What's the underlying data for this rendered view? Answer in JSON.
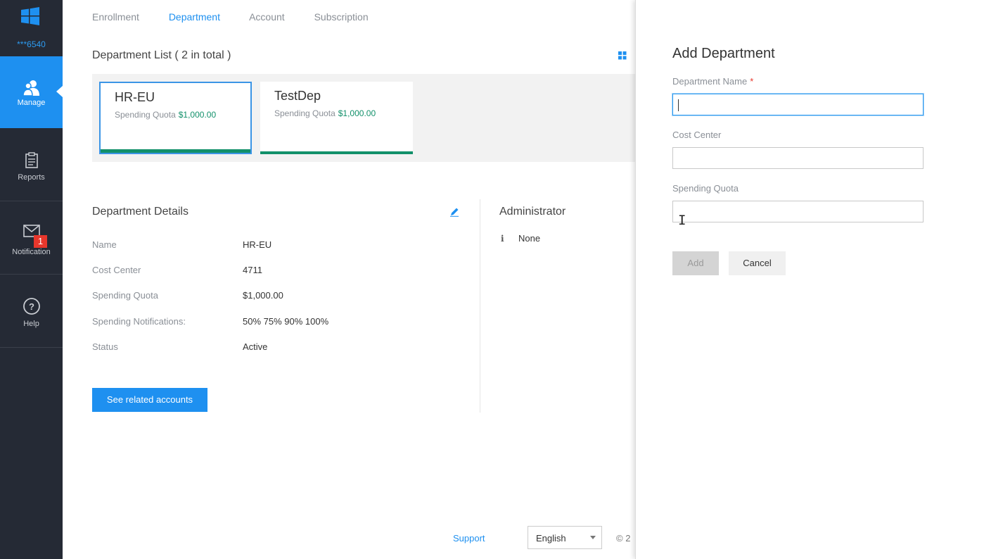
{
  "sidebar": {
    "account": "***6540",
    "items": [
      {
        "label": "Manage",
        "icon": "users-icon"
      },
      {
        "label": "Reports",
        "icon": "clipboard-icon"
      },
      {
        "label": "Notification",
        "icon": "mail-icon",
        "badge": "1"
      },
      {
        "label": "Help",
        "icon": "help-icon"
      }
    ],
    "colors": {
      "background": "#252a35",
      "active": "#1e90f0"
    }
  },
  "tabs": [
    "Enrollment",
    "Department",
    "Account",
    "Subscription"
  ],
  "active_tab": "Department",
  "department_list": {
    "title": "Department List ( 2 in total )",
    "cards": [
      {
        "name": "HR-EU",
        "quota_label": "Spending Quota",
        "quota_value": "$1,000.00",
        "selected": true
      },
      {
        "name": "TestDep",
        "quota_label": "Spending Quota",
        "quota_value": "$1,000.00",
        "selected": false
      }
    ]
  },
  "details": {
    "title": "Department Details",
    "rows": [
      {
        "label": "Name",
        "value": "HR-EU"
      },
      {
        "label": "Cost Center",
        "value": "4711"
      },
      {
        "label": "Spending Quota",
        "value": "$1,000.00"
      },
      {
        "label": "Spending Notifications:",
        "value": "50% 75% 90% 100%"
      },
      {
        "label": "Status",
        "value": "Active"
      }
    ],
    "related_button": "See related accounts"
  },
  "administrator": {
    "title": "Administrator",
    "value": "None"
  },
  "footer": {
    "support": "Support",
    "language": "English",
    "copyright": "© 2"
  },
  "panel": {
    "title": "Add Department",
    "fields": [
      {
        "label": "Department Name",
        "required": "*",
        "value": ""
      },
      {
        "label": "Cost Center",
        "value": ""
      },
      {
        "label": "Spending Quota",
        "value": ""
      }
    ],
    "add_button": "Add",
    "cancel_button": "Cancel"
  }
}
